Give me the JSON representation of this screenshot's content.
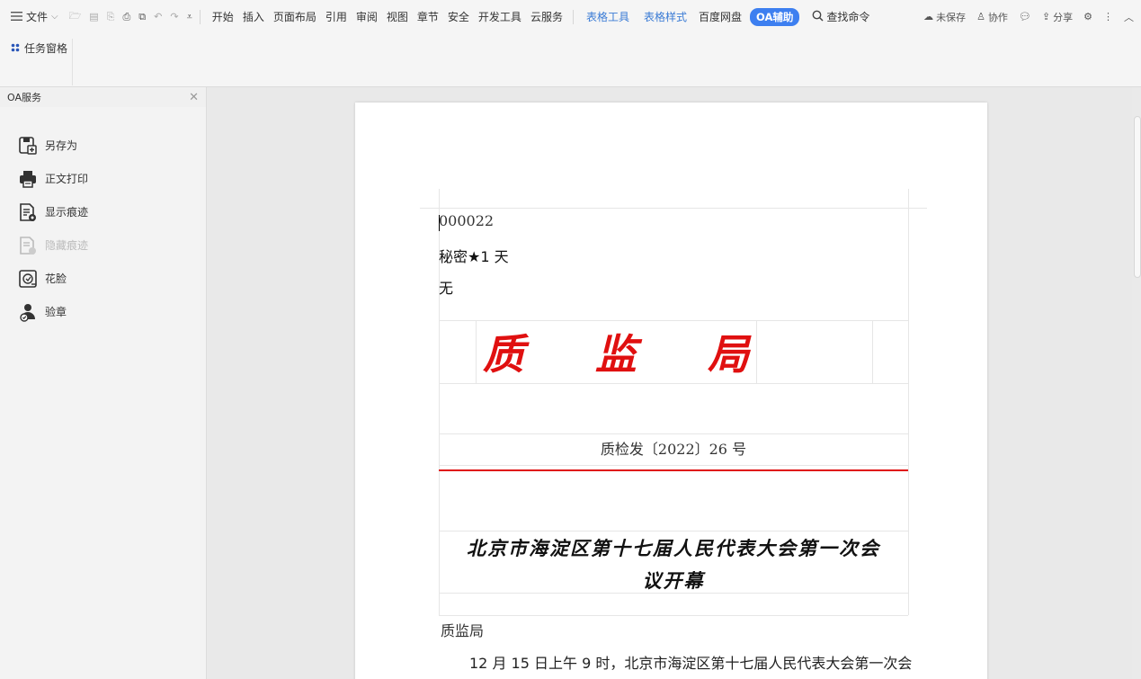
{
  "menubar": {
    "file_label": "文件",
    "tabs": [
      "开始",
      "插入",
      "页面布局",
      "引用",
      "审阅",
      "视图",
      "章节",
      "安全",
      "开发工具",
      "云服务"
    ],
    "context_tabs": [
      "表格工具",
      "表格样式"
    ],
    "baidu_label": "百度网盘",
    "oa_label": "OA辅助",
    "find_label": "查找命令",
    "unsaved_label": "未保存",
    "collab_label": "协作",
    "share_label": "分享"
  },
  "ribbon": {
    "task_pane_label": "任务窗格"
  },
  "sidepanel": {
    "title": "OA服务",
    "items": [
      {
        "label": "另存为",
        "icon": "save-as-icon",
        "enabled": true
      },
      {
        "label": "正文打印",
        "icon": "printer-icon",
        "enabled": true
      },
      {
        "label": "显示痕迹",
        "icon": "show-revisions-icon",
        "enabled": true
      },
      {
        "label": "隐藏痕迹",
        "icon": "hide-revisions-icon",
        "enabled": false
      },
      {
        "label": "花脸",
        "icon": "mask-icon",
        "enabled": true
      },
      {
        "label": "验章",
        "icon": "verify-seal-icon",
        "enabled": true
      }
    ]
  },
  "document": {
    "doc_number": "000022",
    "secret_level": "秘密★1 天",
    "urgency": "无",
    "org_chars": [
      "质",
      "监",
      "局"
    ],
    "doc_no": "质检发〔2022〕26 号",
    "title_line1": "北京市海淀区第十七届人民代表大会第一次会",
    "title_line2": "议开幕",
    "recipient": "质监局",
    "body_line1": "12 月 15 日上午 9 时，北京市海淀区第十七届人民代表大会第一次会"
  },
  "colors": {
    "accent": "#3d7ff0",
    "red_header": "#e01010",
    "context_tab": "#3a7bd5"
  }
}
